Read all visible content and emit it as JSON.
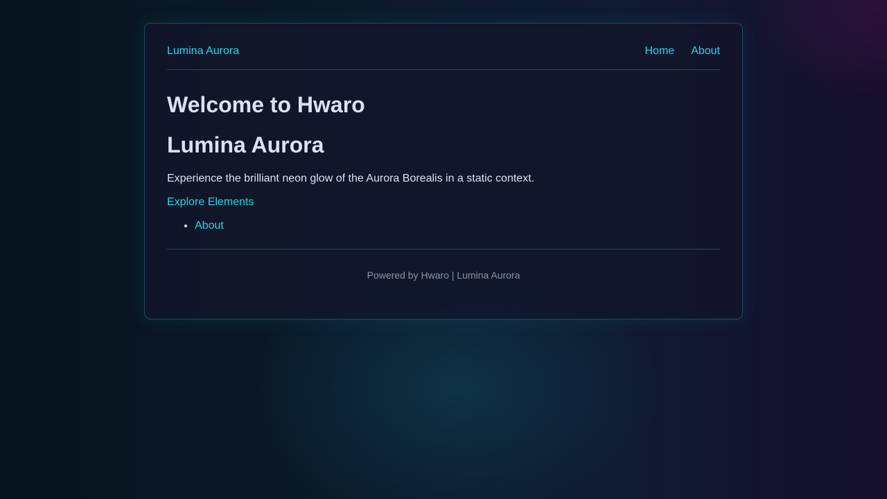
{
  "header": {
    "brand": "Lumina Aurora",
    "nav": [
      {
        "label": "Home"
      },
      {
        "label": "About"
      }
    ]
  },
  "main": {
    "title": "Welcome to Hwaro",
    "subtitle": "Lumina Aurora",
    "description": "Experience the brilliant neon glow of the Aurora Borealis in a static context.",
    "explore_link": "Explore Elements",
    "list_items": [
      {
        "label": "About"
      }
    ]
  },
  "footer": {
    "text": "Powered by Hwaro | Lumina Aurora"
  },
  "colors": {
    "accent": "#22d8ea",
    "heading": "#dde0f7",
    "border": "#1d4c5e",
    "footer_text": "#8c93ad"
  }
}
